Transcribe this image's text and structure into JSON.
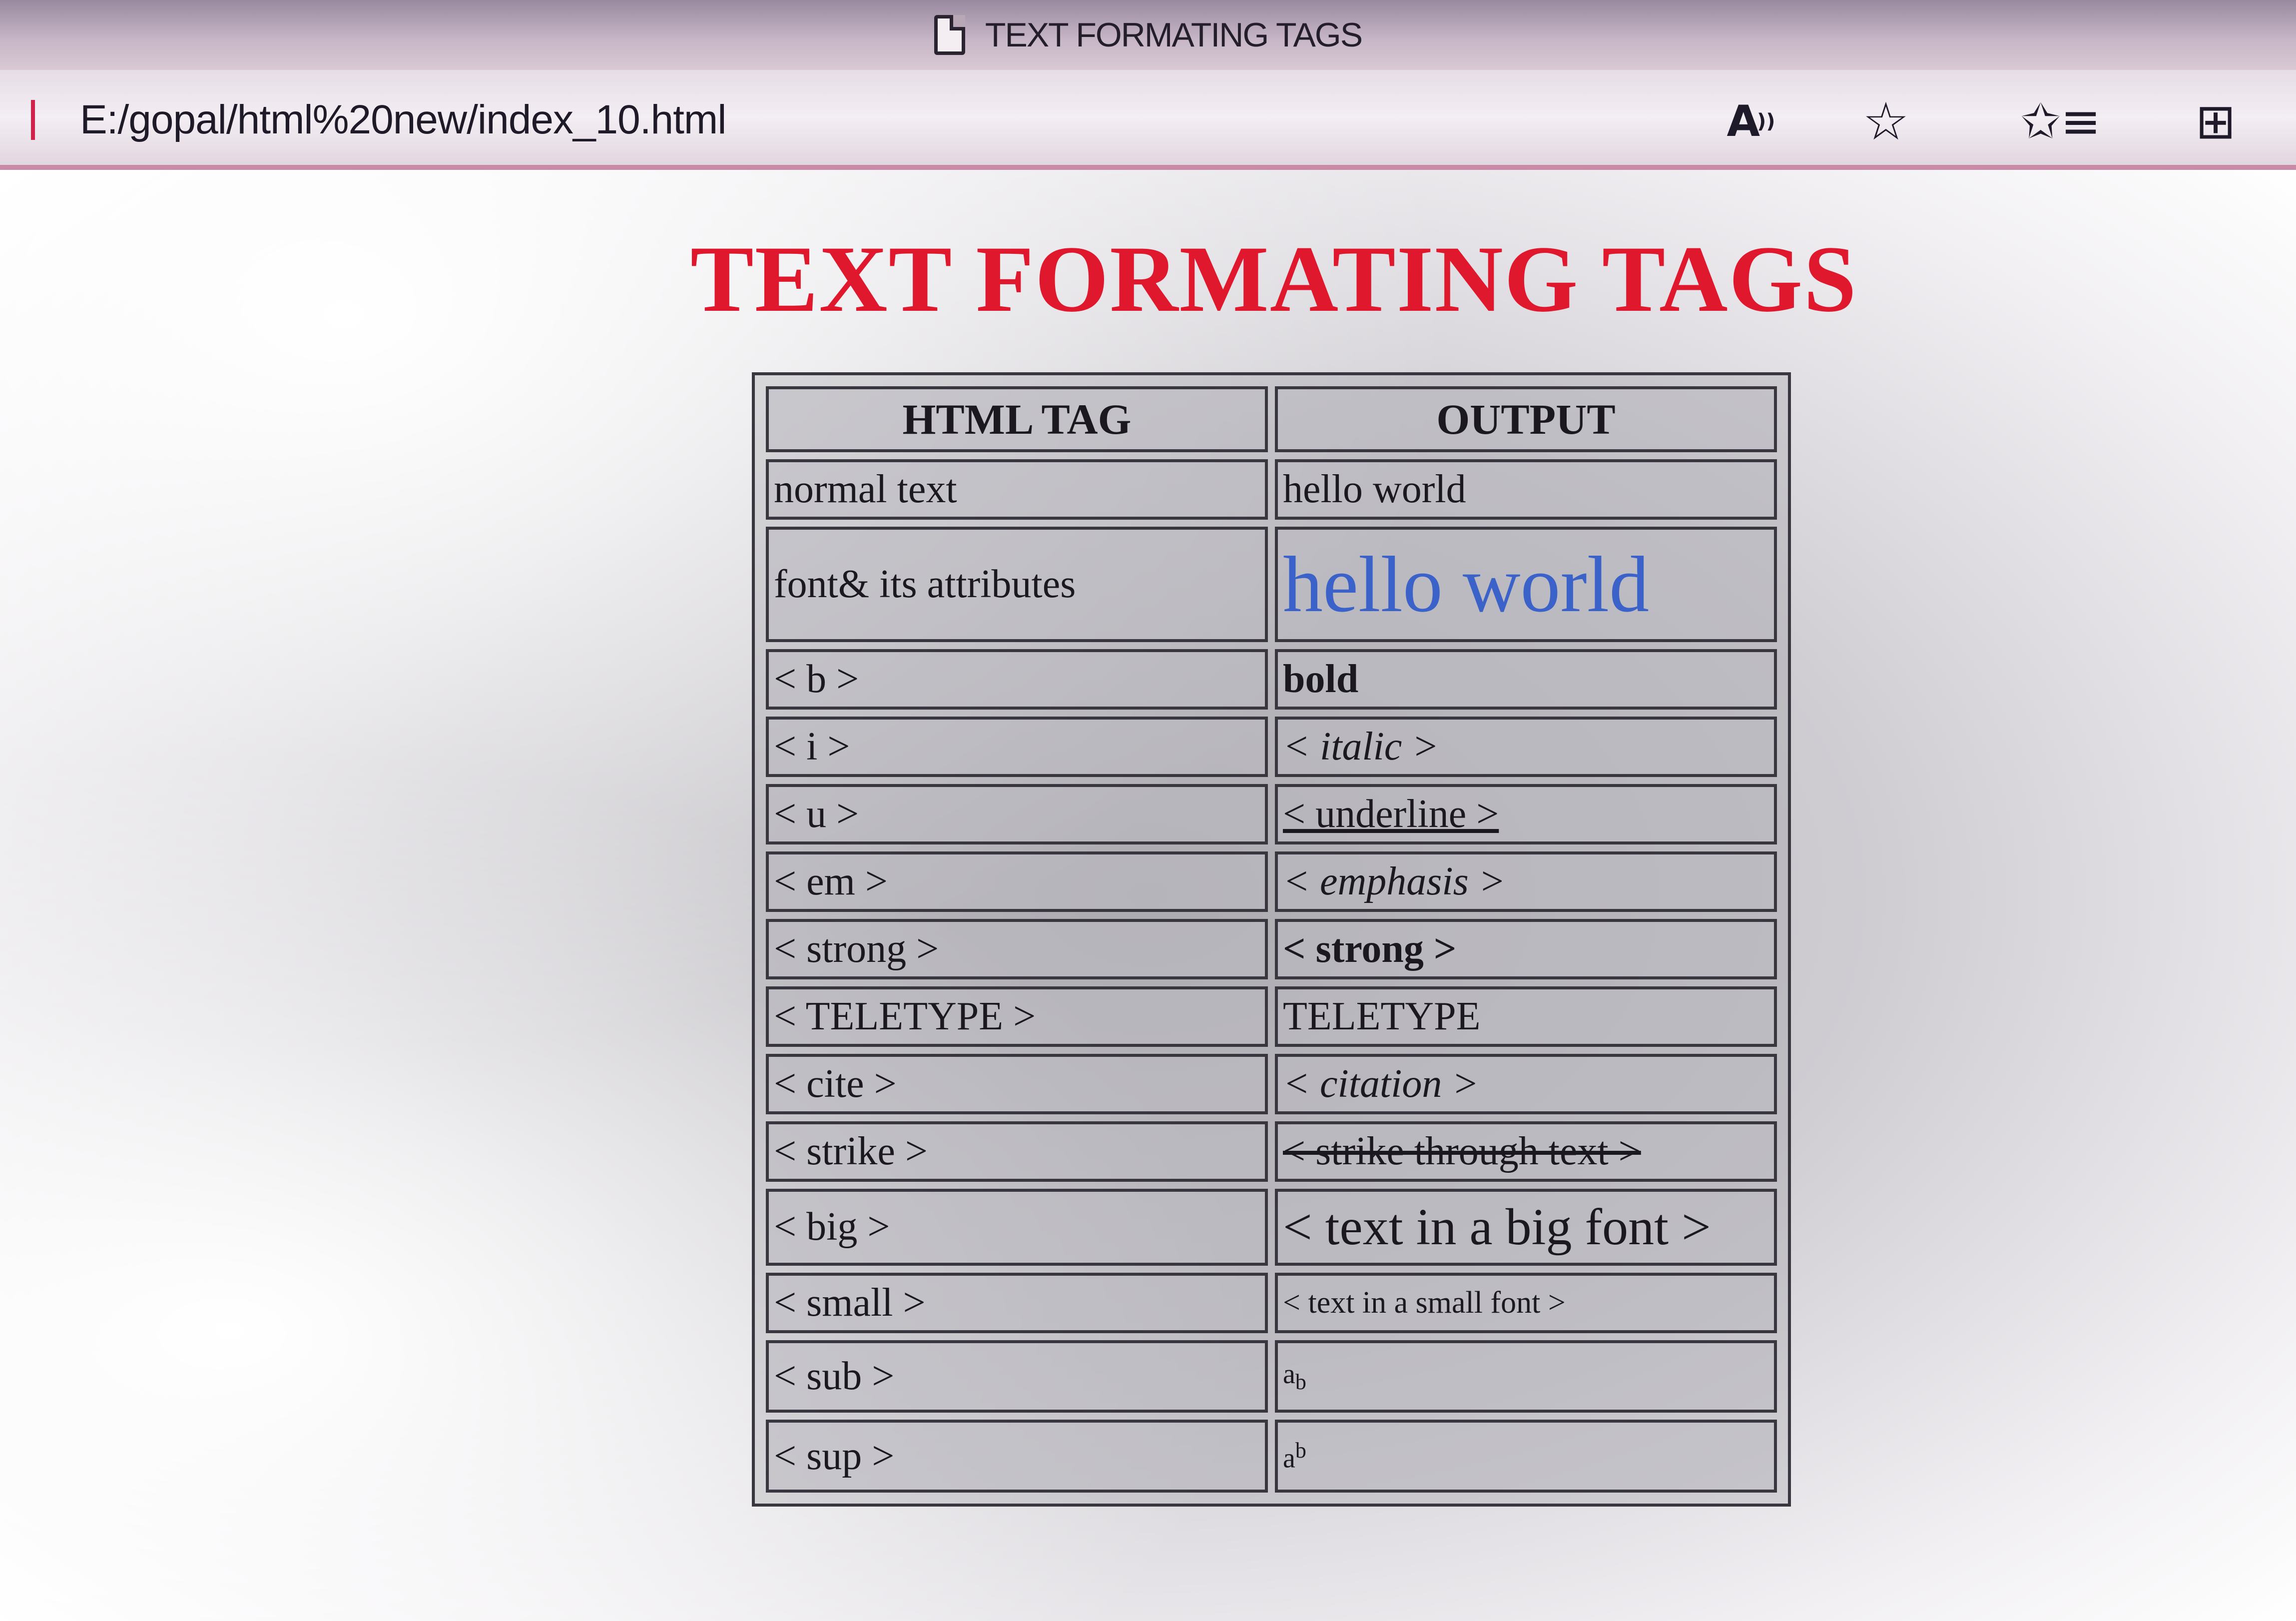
{
  "window": {
    "title": "TEXT FORMATING TAGS",
    "title_icon": "document-icon"
  },
  "address_bar": {
    "url": "E:/gopal/html%20new/index_10.html"
  },
  "toolbar": {
    "read_aloud_icon": "read-aloud-icon",
    "favorite_icon": "star-icon",
    "favorites_list_icon": "favorites-list-icon",
    "collections_icon": "collections-icon"
  },
  "page": {
    "heading": "TEXT FORMATING TAGS",
    "heading_color": "#e0182e",
    "table": {
      "headers": [
        "HTML TAG",
        "OUTPUT"
      ],
      "rows": [
        {
          "tag": "normal text",
          "output": "hello world"
        },
        {
          "tag": "font& its attributes",
          "output": "hello world"
        },
        {
          "tag": "< b >",
          "output": "bold"
        },
        {
          "tag": "< i >",
          "output": "< italic >"
        },
        {
          "tag": "< u >",
          "output": "< underline >"
        },
        {
          "tag": "< em >",
          "output": "< emphasis >"
        },
        {
          "tag": "< strong >",
          "output": "< strong >"
        },
        {
          "tag": "< TELETYPE >",
          "output": "TELETYPE"
        },
        {
          "tag": "< cite >",
          "output": "< citation >"
        },
        {
          "tag": "< strike >",
          "output": "< strike through text >"
        },
        {
          "tag": "< big >",
          "output": "< text in a big font >"
        },
        {
          "tag": "< small >",
          "output": "< text in a small font >"
        },
        {
          "tag": "< sub >",
          "output_base": "a",
          "output_script": "b"
        },
        {
          "tag": "< sup >",
          "output_base": "a",
          "output_script": "b"
        }
      ]
    },
    "font_example_color": "#3a62c8"
  }
}
